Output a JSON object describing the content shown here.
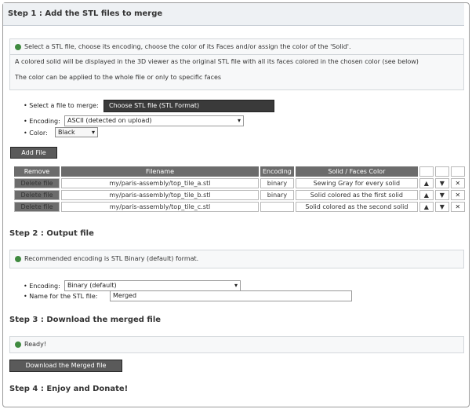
{
  "step1": {
    "title": "Step 1 : Add the STL files to merge",
    "info_text": "Select a STL file, choose its encoding, choose the color of its Faces and/or assign the color of the 'Solid'.",
    "warning_line1": "A colored solid will be displayed in the 3D viewer as the original STL file with all its faces colored in the chosen color (see below)",
    "warning_line2": "The color can be applied to the whole file or only to specific faces",
    "select_label": "Select a file to merge:",
    "select_button": "Choose STL file (STL Format)",
    "encoding_label": "Encoding:",
    "encoding_value": "ASCII (detected on upload)",
    "color_label": "Color:",
    "color_value": "Black",
    "add_button": "Add File"
  },
  "table": {
    "headers": [
      "Remove",
      "Filename",
      "Encoding",
      "Solid / Faces Color",
      "",
      "",
      ""
    ],
    "rows": [
      {
        "remove": "Delete file",
        "filename": "my/paris-assembly/top_tile_a.stl",
        "encoding": "binary",
        "color": "Sewing Gray for every solid",
        "icon1": "▲",
        "icon2": "▼",
        "icon3": "✕"
      },
      {
        "remove": "Delete file",
        "filename": "my/paris-assembly/top_tile_b.stl",
        "encoding": "binary",
        "color": "Solid colored as the first solid",
        "icon1": "▲",
        "icon2": "▼",
        "icon3": "✕"
      },
      {
        "remove": "Delete file",
        "filename": "my/paris-assembly/top_tile_c.stl",
        "encoding": "",
        "color": "Solid colored as the second solid",
        "icon1": "▲",
        "icon2": "▼",
        "icon3": "✕"
      }
    ]
  },
  "step2": {
    "title": "Step 2 : Output file",
    "info_text": "Recommended encoding is STL Binary (default) format.",
    "encoding_label": "Encoding:",
    "encoding_value": "Binary (default)",
    "filename_label": "Name for the STL file:",
    "filename_value": "Merged"
  },
  "step3": {
    "title": "Step 3 : Download the merged file",
    "info_text": "Ready!",
    "download_button": "Download the Merged file"
  },
  "step4": {
    "title": "Step 4 : Enjoy and Donate!"
  },
  "colors": {
    "accent_dark": "#3a3a3a",
    "header_gray": "#6c6c6c",
    "ok_green": "#3f8a3f"
  }
}
